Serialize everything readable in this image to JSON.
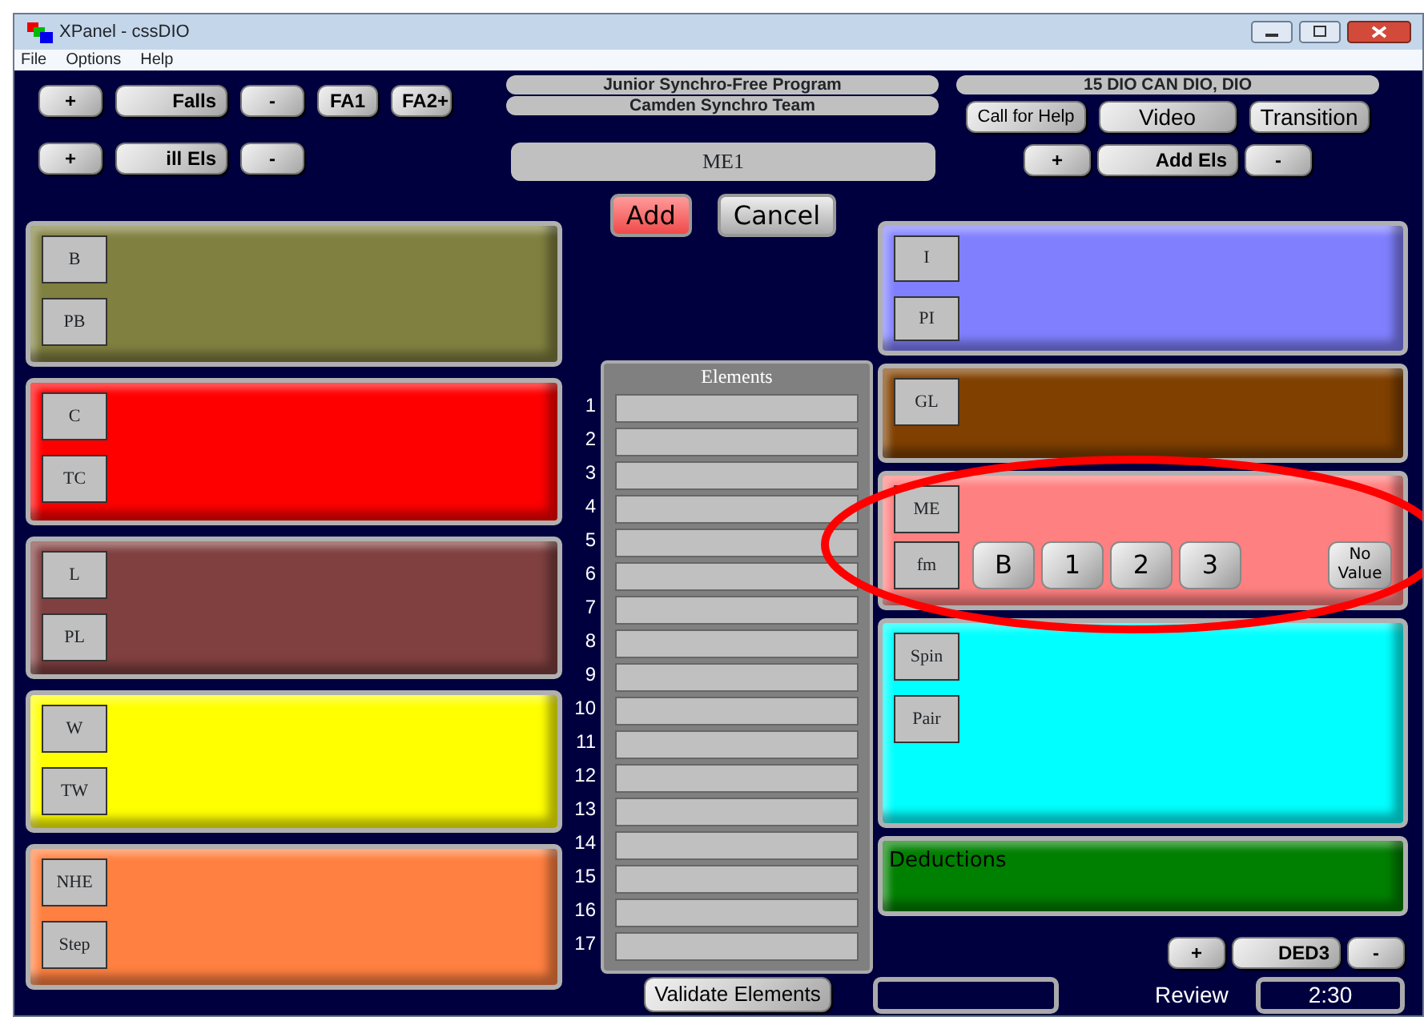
{
  "window": {
    "title": "XPanel - cssDIO"
  },
  "menu": [
    "File",
    "Options",
    "Help"
  ],
  "top_left_rows": [
    [
      "+",
      "Falls",
      "-",
      "FA1",
      "FA2+"
    ],
    [
      "+",
      "ill Els",
      "-"
    ]
  ],
  "program": "Junior Synchro-Free Program",
  "team": "Camden Synchro Team",
  "element_field": {
    "value": "ME1"
  },
  "skater": "15 DIO CAN DIO, DIO",
  "top_right_buttons": [
    "Call for Help",
    "Video",
    "Transition"
  ],
  "add_els_row": [
    "+",
    "Add Els",
    "-"
  ],
  "actions": [
    "Add",
    "Cancel"
  ],
  "left_panels": [
    {
      "color": "#808040",
      "labels": [
        "B",
        "PB"
      ]
    },
    {
      "color": "#ff0000",
      "labels": [
        "C",
        "TC"
      ]
    },
    {
      "color": "#804040",
      "labels": [
        "L",
        "PL"
      ]
    },
    {
      "color": "#ffff00",
      "labels": [
        "W",
        "TW"
      ]
    },
    {
      "color": "#ff8040",
      "labels": [
        "NHE",
        "Step"
      ]
    }
  ],
  "elements": {
    "title": "Elements",
    "numbers": [
      "1",
      "2",
      "3",
      "4",
      "5",
      "6",
      "7",
      "8",
      "9",
      "10",
      "11",
      "12",
      "13",
      "14",
      "15",
      "16",
      "17"
    ]
  },
  "validate": "Validate Elements",
  "right_panels": [
    {
      "kind": "labels",
      "color": "#8080ff",
      "labels": [
        "I",
        "PI"
      ]
    },
    {
      "kind": "labels",
      "color": "#804000",
      "labels": [
        "GL"
      ]
    },
    {
      "kind": "values",
      "color": "#ff8080",
      "labels": [
        "ME",
        "fm"
      ],
      "values": [
        "B",
        "1",
        "2",
        "3"
      ],
      "no_value": "No Value"
    },
    {
      "kind": "labels",
      "color": "#00ffff",
      "labels": [
        "Spin",
        "Pair"
      ]
    },
    {
      "kind": "title",
      "color": "#008000",
      "title": "Deductions"
    }
  ],
  "ded_row": [
    "+",
    "DED3",
    "-"
  ],
  "review": {
    "label": "Review",
    "time": "2:30"
  }
}
